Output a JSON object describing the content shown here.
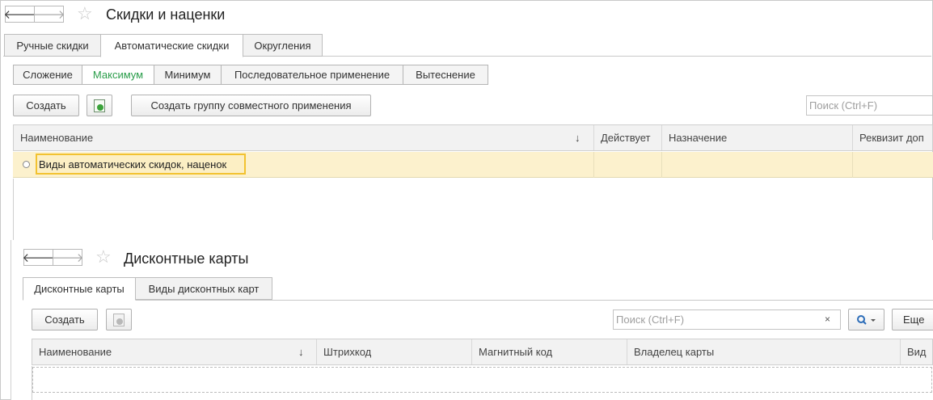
{
  "discounts": {
    "title": "Скидки и наценки",
    "tabs": [
      "Ручные скидки",
      "Автоматические скидки",
      "Округления"
    ],
    "active_tab": 1,
    "modes": [
      "Сложение",
      "Максимум",
      "Минимум",
      "Последовательное применение",
      "Вытеснение"
    ],
    "active_mode": 1,
    "create_label": "Создать",
    "create_group_label": "Создать группу совместного применения",
    "search_placeholder": "Поиск (Ctrl+F)",
    "columns": [
      "Наименование",
      "Действует",
      "Назначение",
      "Реквизит доп"
    ],
    "sort_indicator": "↓",
    "rows": [
      {
        "name": "Виды автоматических скидок, наценок"
      }
    ]
  },
  "cards": {
    "title": "Дисконтные карты",
    "tabs": [
      "Дисконтные карты",
      "Виды дисконтных карт"
    ],
    "active_tab": 0,
    "create_label": "Создать",
    "search_placeholder": "Поиск (Ctrl+F)",
    "clear_symbol": "×",
    "more_label": "Еще",
    "columns": [
      "Наименование",
      "Штрихкод",
      "Магнитный код",
      "Владелец карты",
      "Вид"
    ],
    "sort_indicator": "↓"
  },
  "icons": {
    "back": "arrow-left-icon",
    "forward": "arrow-right-icon",
    "favorite": "star-icon",
    "add_copy": "add-copy-icon",
    "search": "search-icon"
  },
  "colors": {
    "accent_green": "#2a9d4a",
    "selection_fill": "#fcf1cd",
    "selection_border": "#f2c230",
    "search_blue": "#2b6cb8"
  }
}
